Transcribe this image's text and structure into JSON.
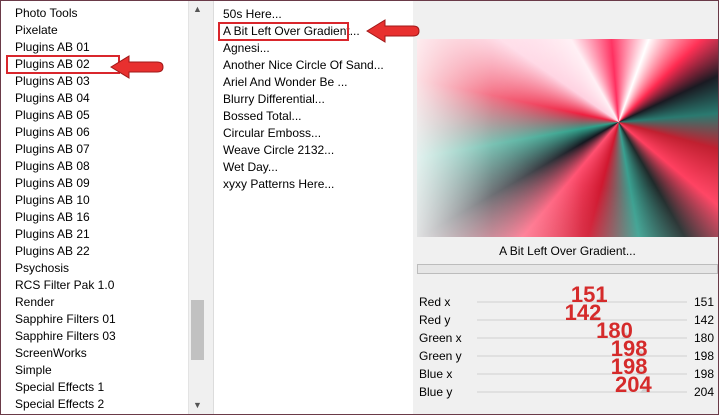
{
  "categories": [
    "Photo Tools",
    "Pixelate",
    "Plugins AB 01",
    "Plugins AB 02",
    "Plugins AB 03",
    "Plugins AB 04",
    "Plugins AB 05",
    "Plugins AB 06",
    "Plugins AB 07",
    "Plugins AB 08",
    "Plugins AB 09",
    "Plugins AB 10",
    "Plugins AB 16",
    "Plugins AB 21",
    "Plugins AB 22",
    "Psychosis",
    "RCS Filter Pak 1.0",
    "Render",
    "Sapphire Filters 01",
    "Sapphire Filters 03",
    "ScreenWorks",
    "Simple",
    "Special Effects 1",
    "Special Effects 2"
  ],
  "selected_category": "Plugins AB 02",
  "filters": [
    "50s Here...",
    "A Bit Left Over Gradient...",
    "Agnesi...",
    "Another Nice Circle Of Sand...",
    "Ariel And Wonder Be ...",
    "Blurry Differential...",
    "Bossed Total...",
    "Circular Emboss...",
    "Weave Circle 2132...",
    "Wet Day...",
    "xyxy Patterns Here..."
  ],
  "selected_filter": "A Bit Left Over Gradient...",
  "preview_title": "A Bit Left Over Gradient...",
  "params": [
    {
      "name": "Red x",
      "value": "151",
      "annotation": "151",
      "slider": 0.59
    },
    {
      "name": "Red y",
      "value": "142",
      "annotation": "142",
      "slider": 0.56
    },
    {
      "name": "Green x",
      "value": "180",
      "annotation": "180",
      "slider": 0.71
    },
    {
      "name": "Green y",
      "value": "198",
      "annotation": "198",
      "slider": 0.78
    },
    {
      "name": "Blue x",
      "value": "198",
      "annotation": "198",
      "slider": 0.78
    },
    {
      "name": "Blue y",
      "value": "204",
      "annotation": "204",
      "slider": 0.8
    }
  ],
  "accent_color": "#d9262c"
}
